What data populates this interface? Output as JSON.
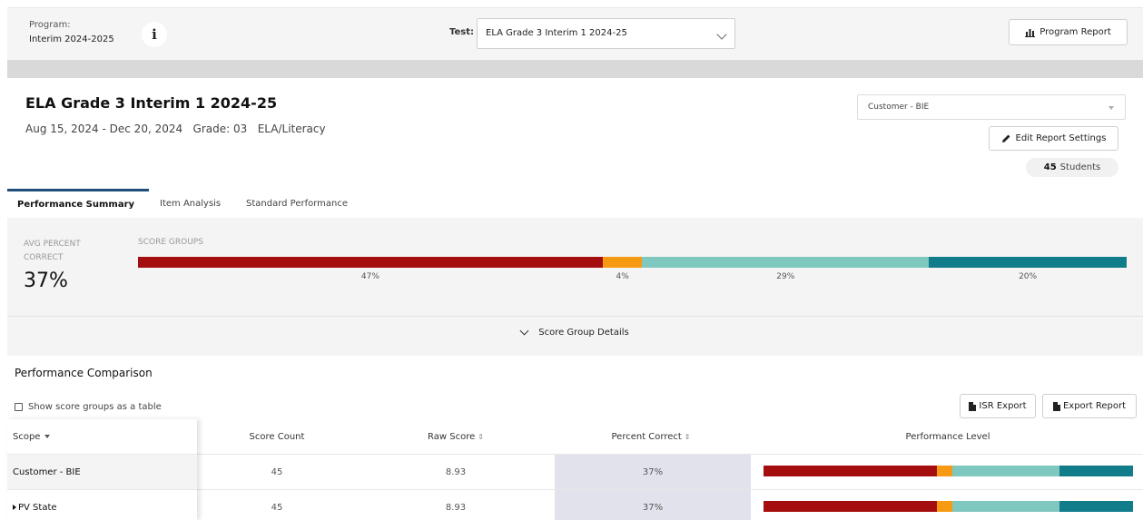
{
  "topbar": {
    "program_label": "Program:",
    "program_value": "Interim 2024-2025",
    "info_icon": "info-icon",
    "test_label": "Test:",
    "test_value": "ELA Grade 3 Interim 1 2024-25",
    "program_report_label": "Program Report"
  },
  "header": {
    "title": "ELA Grade 3 Interim 1 2024-25",
    "subtitle": "Aug 15, 2024 - Dec 20, 2024   Grade: 03   ELA/Literacy",
    "customer_value": "Customer - BIE",
    "edit_settings_label": "Edit Report Settings",
    "students_count": "45",
    "students_label": "Students"
  },
  "tabs": [
    {
      "label": "Performance Summary",
      "active": true
    },
    {
      "label": "Item Analysis",
      "active": false
    },
    {
      "label": "Standard Performance",
      "active": false
    }
  ],
  "summary": {
    "avg_label": "AVG PERCENT CORRECT",
    "avg_value": "37%",
    "score_groups_label": "SCORE GROUPS",
    "score_groups": [
      {
        "percent": 47,
        "label": "47%",
        "color": "#a50e0e"
      },
      {
        "percent": 4,
        "label": "4%",
        "color": "#f59a12"
      },
      {
        "percent": 29,
        "label": "29%",
        "color": "#7fc8bf"
      },
      {
        "percent": 20,
        "label": "20%",
        "color": "#127d8a"
      }
    ],
    "details_label": "Score Group Details"
  },
  "comparison": {
    "title": "Performance Comparison",
    "show_table_label": "Show score groups as a table",
    "isr_export_label": "ISR Export",
    "export_report_label": "Export Report",
    "columns": {
      "scope": "Scope",
      "score_count": "Score Count",
      "raw_score": "Raw Score",
      "percent_correct": "Percent Correct",
      "performance_level": "Performance Level"
    },
    "rows": [
      {
        "scope": "Customer - BIE",
        "score_count": "45",
        "raw_score": "8.93",
        "percent_correct": "37%",
        "expandable": false,
        "levels": [
          47,
          4,
          29,
          20
        ]
      },
      {
        "scope": "PV State",
        "score_count": "45",
        "raw_score": "8.93",
        "percent_correct": "37%",
        "expandable": true,
        "levels": [
          47,
          4,
          29,
          20
        ]
      }
    ]
  }
}
